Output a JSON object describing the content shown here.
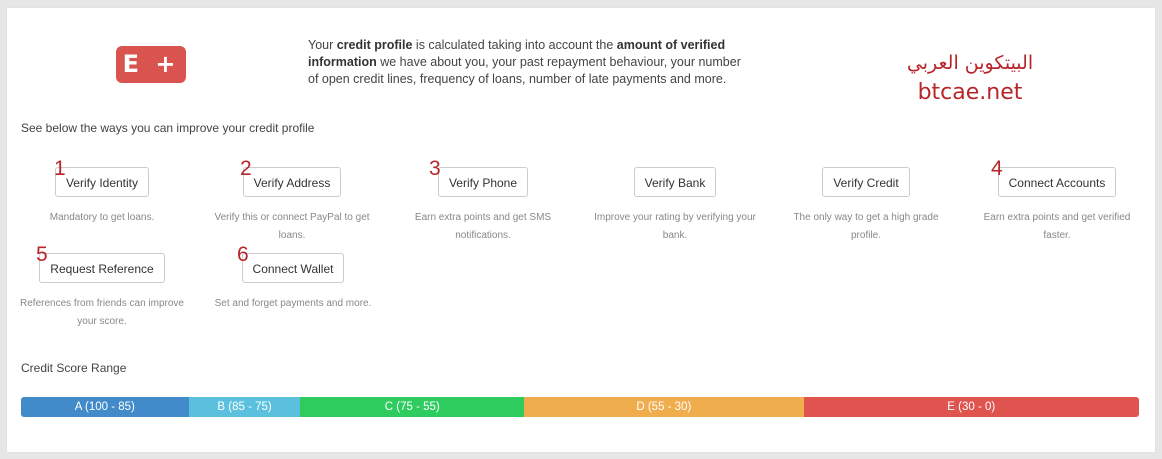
{
  "logo": {
    "label": "E +",
    "color": "#d9534f"
  },
  "intro": {
    "part1": "Your ",
    "bold1": "credit profile",
    "part2": " is calculated taking into account the ",
    "bold2": "amount of verified information",
    "part3": " we have about you, your past repayment behaviour, your number of open credit lines, frequency of loans, number of late payments and more."
  },
  "watermark": {
    "arabic": "البيتكوين العربي",
    "site": "btcae.net",
    "color": "#b8262b"
  },
  "improve_heading": "See below the ways you can improve your credit profile",
  "items": [
    {
      "number": "1",
      "label": "Verify Identity",
      "desc": "Mandatory to get loans."
    },
    {
      "number": "2",
      "label": "Verify Address",
      "desc": "Verify this or connect PayPal to get loans."
    },
    {
      "number": "3",
      "label": "Verify Phone",
      "desc": "Earn extra points and get SMS notifications."
    },
    {
      "number": "",
      "label": "Verify Bank",
      "desc": "Improve your rating by verifying your bank."
    },
    {
      "number": "",
      "label": "Verify Credit",
      "desc": "The only way to get a high grade profile."
    },
    {
      "number": "4",
      "label": "Connect Accounts",
      "desc": "Earn extra points and get verified faster."
    },
    {
      "number": "5",
      "label": "Request Reference",
      "desc": "References from friends can improve your score."
    },
    {
      "number": "6",
      "label": "Connect Wallet",
      "desc": "Set and forget payments and more."
    }
  ],
  "credit_range": {
    "title": "Credit Score Range",
    "segments": [
      {
        "label": "A (100 - 85)",
        "color": "#428bca",
        "share": 15
      },
      {
        "label": "B (85 - 75)",
        "color": "#5bc0de",
        "share": 10
      },
      {
        "label": "C (75 - 55)",
        "color": "#2ecc5e",
        "share": 20
      },
      {
        "label": "D (55 - 30)",
        "color": "#f0ad4e",
        "share": 25
      },
      {
        "label": "E (30 - 0)",
        "color": "#e05450",
        "share": 30
      }
    ]
  }
}
